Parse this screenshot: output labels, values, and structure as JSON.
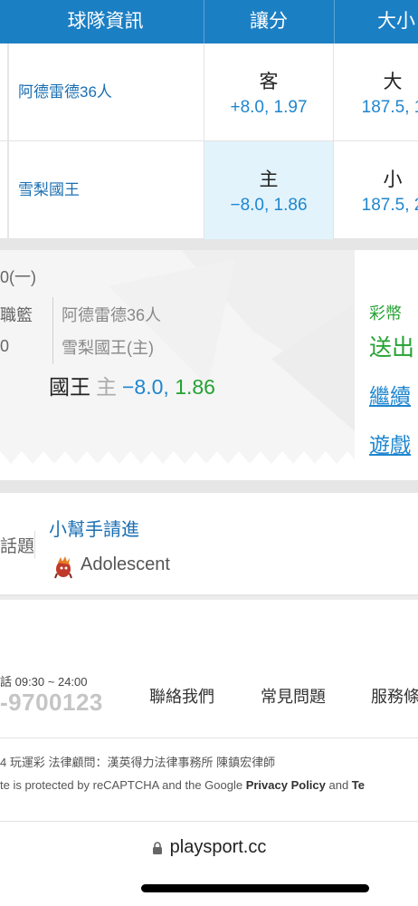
{
  "table": {
    "headers": {
      "team": "球隊資訊",
      "spread": "讓分",
      "over_under": "大小"
    },
    "rows": [
      {
        "team": "阿德雷德36人",
        "spread_side": "客",
        "spread_odds": "+8.0, 1.97",
        "ou_side": "大",
        "ou_odds": "187.5, 1",
        "highlighted": false
      },
      {
        "team": "雪梨國王",
        "spread_side": "主",
        "spread_odds": "−8.0, 1.86",
        "ou_side": "小",
        "ou_odds": "187.5, 2",
        "highlighted": true
      }
    ]
  },
  "ticket": {
    "date": "0(一)",
    "league": "職籃",
    "number": "0",
    "away_team": "阿德雷德36人",
    "home_team": "雪梨國王(主)",
    "pick_team": "國王",
    "pick_side": "主",
    "pick_line": "−8.0,",
    "pick_odds": "1.86"
  },
  "promo": {
    "label": "彩幣",
    "headline": "送出",
    "link_continue": "繼續",
    "link_game": "遊戲"
  },
  "helper": {
    "topic_label": "話題",
    "title": "小幫手請進",
    "username": "Adolescent"
  },
  "footer": {
    "hours": "話 09:30 ~ 24:00",
    "phone": "-9700123",
    "links": [
      "聯絡我們",
      "常見問題",
      "服務條"
    ],
    "copyright": "4 玩運彩 法律顧問：漢英得力法律事務所 陳鎮宏律師",
    "captcha_prefix": "te is protected by reCAPTCHA and the Google ",
    "privacy_policy": "Privacy Policy",
    "and": " and ",
    "terms": "Te"
  },
  "browser": {
    "url": "playsport.cc"
  },
  "colors": {
    "header_blue": "#1b7fc4",
    "link_blue": "#1f86cf",
    "odds_green": "#25a233",
    "highlight_cell": "#e2f3fc"
  },
  "icons": [
    "lock-icon",
    "avatar-icon"
  ]
}
